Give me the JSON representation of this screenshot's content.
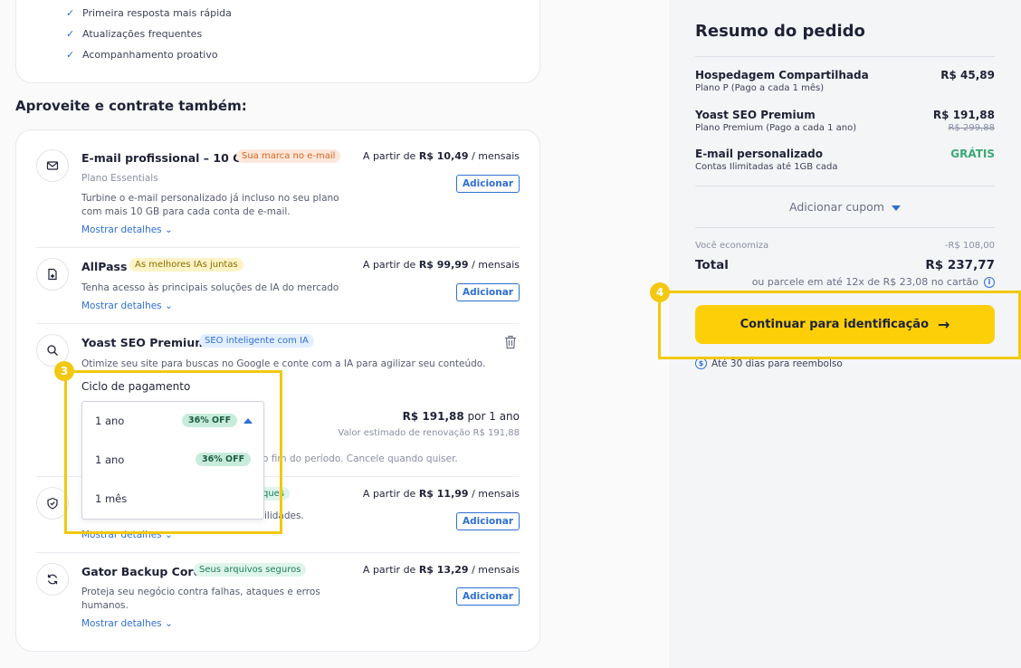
{
  "features": [
    "Primeira resposta mais rápida",
    "Atualizações frequentes",
    "Acompanhamento proativo"
  ],
  "section_title": "Aproveite e contrate também:",
  "addons": {
    "email": {
      "title": "E-mail profissional – 10 GB",
      "badge": "Sua marca no e-mail",
      "subtitle": "Plano Essentials",
      "desc": "Turbine o e-mail personalizado já incluso no seu plano com mais 10 GB para cada conta de e-mail.",
      "link": "Mostrar detalhes",
      "price_prefix": "A partir de ",
      "price": "R$ 10,49",
      "price_suffix": " / mensais",
      "button": "Adicionar"
    },
    "allpass": {
      "title": "AllPass",
      "badge": "As melhores IAs juntas",
      "desc": "Tenha acesso às principais soluções de IA do mercado",
      "link": "Mostrar detalhes",
      "price_prefix": "A partir de ",
      "price": "R$ 99,99",
      "price_suffix": " / mensais",
      "button": "Adicionar"
    },
    "yoast": {
      "title": "Yoast SEO Premium",
      "badge": "SEO inteligente com IA",
      "desc": "Otimize seu site para buscas no Google e conte com a IA para agilizar seu conteúdo.",
      "cycle_label": "Ciclo de pagamento",
      "selected": "1 ano",
      "selected_badge": "36% OFF",
      "options": [
        {
          "label": "1 ano",
          "badge": "36% OFF"
        },
        {
          "label": "1 mês",
          "badge": ""
        }
      ],
      "price": "R$ 191,88",
      "price_suffix": " por 1 ano",
      "renewal": "Valor estimado de renovação R$ 191,88",
      "cancel_note": "o fim do período. Cancele quando quiser."
    },
    "security": {
      "badge_partial": "ques",
      "desc_partial": "ilidades.",
      "link": "Mostrar detalhes",
      "price_prefix": "A partir de ",
      "price": "R$ 11,99",
      "price_suffix": " / mensais",
      "button": "Adicionar"
    },
    "backup": {
      "title": "Gator Backup Core",
      "badge": "Seus arquivos seguros",
      "desc": "Proteja seu negócio contra falhas, ataques e erros humanos.",
      "link": "Mostrar detalhes",
      "price_prefix": "A partir de ",
      "price": "R$ 13,29",
      "price_suffix": " / mensais",
      "button": "Adicionar"
    }
  },
  "highlights": {
    "step3": "3",
    "step4": "4"
  },
  "summary": {
    "title": "Resumo do pedido",
    "items": [
      {
        "name": "Hospedagem Compartilhada",
        "plan": "Plano P (Pago a cada 1 mês)",
        "price": "R$ 45,89"
      },
      {
        "name": "Yoast SEO Premium",
        "plan": "Plano Premium (Pago a cada 1 ano)",
        "price": "R$ 191,88",
        "old_price": "R$ 299,88"
      },
      {
        "name": "E-mail personalizado",
        "plan": "Contas Ilimitadas até 1GB cada",
        "price": "GRÁTIS"
      }
    ],
    "coupon": "Adicionar cupom",
    "savings_label": "Você economiza",
    "savings_value": "-R$ 108,00",
    "total_label": "Total",
    "total_value": "R$ 237,77",
    "installment": "ou parcele em até 12x de R$ 23,08 no cartão",
    "continue_button": "Continuar para identificação",
    "refund": "Até 30 dias para reembolso"
  },
  "colors": {
    "accent": "#2e6fd4",
    "cta": "#fccf09",
    "highlight": "#f2c811",
    "free": "#3aa876"
  }
}
